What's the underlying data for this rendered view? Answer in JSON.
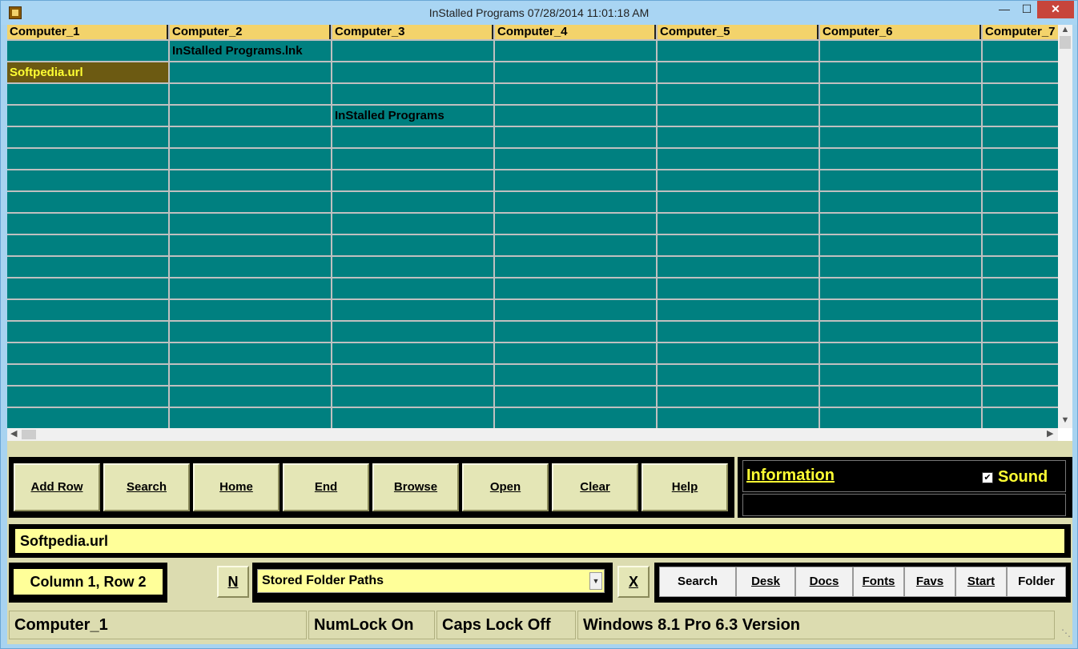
{
  "window": {
    "title": "InStalled Programs 07/28/2014  11:01:18 AM",
    "minimize": "—",
    "maximize": "☐",
    "close": "✕"
  },
  "grid": {
    "columns": [
      "Computer_1",
      "Computer_2",
      "Computer_3",
      "Computer_4",
      "Computer_5",
      "Computer_6",
      "Computer_7"
    ],
    "rows": [
      [
        "",
        "InStalled Programs.lnk",
        "",
        "",
        "",
        "",
        ""
      ],
      [
        "Softpedia.url",
        "",
        "",
        "",
        "",
        "",
        ""
      ],
      [
        "",
        "",
        "",
        "",
        "",
        "",
        ""
      ],
      [
        "",
        "",
        "InStalled Programs",
        "",
        "",
        "",
        ""
      ],
      [
        "",
        "",
        "",
        "",
        "",
        "",
        ""
      ],
      [
        "",
        "",
        "",
        "",
        "",
        "",
        ""
      ],
      [
        "",
        "",
        "",
        "",
        "",
        "",
        ""
      ],
      [
        "",
        "",
        "",
        "",
        "",
        "",
        ""
      ],
      [
        "",
        "",
        "",
        "",
        "",
        "",
        ""
      ],
      [
        "",
        "",
        "",
        "",
        "",
        "",
        ""
      ],
      [
        "",
        "",
        "",
        "",
        "",
        "",
        ""
      ],
      [
        "",
        "",
        "",
        "",
        "",
        "",
        ""
      ],
      [
        "",
        "",
        "",
        "",
        "",
        "",
        ""
      ],
      [
        "",
        "",
        "",
        "",
        "",
        "",
        ""
      ],
      [
        "",
        "",
        "",
        "",
        "",
        "",
        ""
      ],
      [
        "",
        "",
        "",
        "",
        "",
        "",
        ""
      ],
      [
        "",
        "",
        "",
        "",
        "",
        "",
        ""
      ],
      [
        "",
        "",
        "",
        "",
        "",
        "",
        ""
      ]
    ],
    "selected_cell": "Softpedia.url"
  },
  "actions": {
    "add_row": "Add Row",
    "search": "Search",
    "home": "Home",
    "end": "End",
    "browse": "Browse",
    "open": "Open",
    "clear": "Clear",
    "help": "Help"
  },
  "info": {
    "title": "Information",
    "sound_label": "Sound",
    "sound_checked": "✔"
  },
  "path_value": "Softpedia.url",
  "position_label": "Column 1, Row 2",
  "new_button": "N",
  "folder_combo": {
    "selected": "Stored Folder Paths",
    "arrow": "▼"
  },
  "clear_x_button": "X",
  "quick": {
    "search": "Search",
    "desk": "Desk",
    "docs": "Docs",
    "fonts": "Fonts",
    "favs": "Favs",
    "start": "Start",
    "folder": "Folder"
  },
  "status": {
    "column_name": "Computer_1",
    "numlock": "NumLock On",
    "capslock": "Caps Lock Off",
    "os": "Windows 8.1 Pro 6.3 Version"
  },
  "colors": {
    "grid_cell": "#008080",
    "header": "#f3d36b",
    "field_yellow": "#ffff99",
    "accent_text": "#ffff33"
  }
}
